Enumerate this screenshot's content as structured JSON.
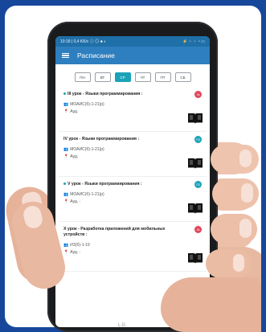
{
  "status": {
    "left": "10:18 | 0,4 KБ/с ⓘ ◎ ♣ ◐",
    "right": "⚡ ⁘ ⁘ ◔ ▭"
  },
  "app": {
    "title": "Расписание"
  },
  "days": [
    {
      "label": "ПН",
      "active": false
    },
    {
      "label": "ВТ",
      "active": false
    },
    {
      "label": "СР",
      "active": true
    },
    {
      "label": "ЧТ",
      "active": false
    },
    {
      "label": "ПТ",
      "active": false
    },
    {
      "label": "СБ",
      "active": false
    }
  ],
  "lessons": [
    {
      "title": "III урок - Языки программирования :",
      "badge": "Лк",
      "badge_color": "#e0475b",
      "group": "МОАИС(б)-1-21(р)",
      "room": "Ауд."
    },
    {
      "title": "IV урок - Языки программирования :",
      "badge": "ПЗ",
      "badge_color": "#1aa3b8",
      "group": "МОАИС(б)-1-21(р)",
      "room": "Ауд."
    },
    {
      "title": "V урок - Языки программирования :",
      "badge": "ПЗ",
      "badge_color": "#1aa3b8",
      "group": "МОАИС(б)-1-21(р)",
      "room": "Ауд. -"
    },
    {
      "title": "X урок - Разработка приложений для мобильных устройств :",
      "badge": "Лк",
      "badge_color": "#e0475b",
      "group": "ИЗ(б)-1-19",
      "room": "Ауд. -"
    }
  ],
  "phone": {
    "brand": "LG"
  },
  "colors": {
    "background": "#17479a",
    "appbar": "#2e7fbf",
    "accent": "#1aa3b8",
    "lecture": "#e0475b"
  }
}
